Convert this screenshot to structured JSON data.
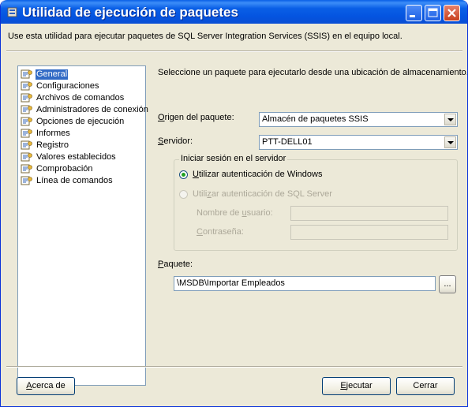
{
  "window": {
    "title": "Utilidad de ejecución de paquetes",
    "description": "Use esta utilidad para ejecutar paquetes de SQL Server Integration Services (SSIS) en el equipo local."
  },
  "tree": {
    "items": [
      {
        "label": "General",
        "selected": true
      },
      {
        "label": "Configuraciones"
      },
      {
        "label": "Archivos de comandos"
      },
      {
        "label": "Administradores de conexión"
      },
      {
        "label": "Opciones de ejecución"
      },
      {
        "label": "Informes"
      },
      {
        "label": "Registro"
      },
      {
        "label": "Valores establecidos"
      },
      {
        "label": "Comprobación"
      },
      {
        "label": "Línea de comandos"
      }
    ]
  },
  "main": {
    "instruction": "Seleccione un paquete para ejecutarlo desde una ubicación de almacenamiento.",
    "origin": {
      "label_u": "O",
      "label_rest": "rigen del paquete:",
      "value": "Almacén de paquetes SSIS"
    },
    "server": {
      "label_u": "S",
      "label_rest": "ervidor:",
      "value": "PTT-DELL01"
    },
    "login_group": {
      "title": "Iniciar sesión en el servidor",
      "windows_auth": {
        "u": "U",
        "rest": "tilizar autenticación de Windows",
        "selected": true
      },
      "sql_auth": {
        "pre": "Utili",
        "u": "z",
        "rest": "ar autenticación de SQL Server",
        "selected": false,
        "enabled": false
      },
      "username": {
        "pre": "Nombre de ",
        "u": "u",
        "rest": "suario:",
        "value": ""
      },
      "password": {
        "u": "C",
        "rest": "ontraseña:",
        "value": ""
      }
    },
    "package": {
      "label_u": "P",
      "label_rest": "aquete:",
      "value": "\\MSDB\\Importar Empleados",
      "browse_label": "..."
    }
  },
  "footer": {
    "about": {
      "pre": "",
      "u": "A",
      "rest": "cerca de"
    },
    "execute": {
      "pre": "",
      "u": "E",
      "rest": "jecutar"
    },
    "close": {
      "label": "Cerrar"
    }
  },
  "colors": {
    "titlebar": "#0a5fe6",
    "selection": "#316ac5",
    "dialog_bg": "#ece9d8"
  }
}
